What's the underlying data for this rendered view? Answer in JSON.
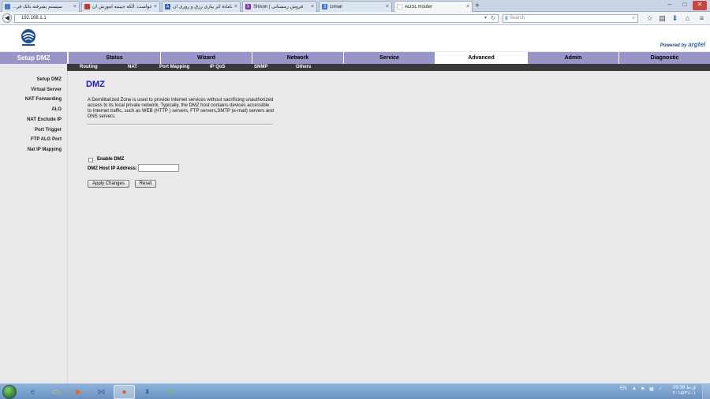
{
  "browser": {
    "tabs": [
      {
        "title": "...سیستم یشرفته بانک قر",
        "active": false,
        "fav_color": "#4a7bc0"
      },
      {
        "title": "درخواست: الکه جیبتیه آموزش ان...",
        "active": false,
        "fav_color": "#c0392b"
      },
      {
        "title": "سامانهٔ اثر بیاری رزق و روزی ان...",
        "active": false,
        "fav_color": "#2a5db0",
        "fav_glyph": "A"
      },
      {
        "title": "Shixon | فروش زمستانی",
        "active": false,
        "fav_color": "#7b2fa8",
        "fav_glyph": "X"
      },
      {
        "title": "Gmail",
        "active": false,
        "fav_color": "#3b6fd4",
        "fav_glyph": "3"
      },
      {
        "title": "ADSL Router",
        "active": true,
        "fav_color": "#ffffff"
      }
    ],
    "new_tab": "+",
    "close_glyph": "×",
    "url": "192.168.1.1",
    "search_placeholder": "Search",
    "window_controls": [
      "–",
      "□",
      "✕"
    ]
  },
  "router": {
    "powered_by_prefix": "Powered by",
    "powered_by_brand": "argtel",
    "section_title": "Setup DMZ",
    "main_nav": [
      "Status",
      "Wizard",
      "Network",
      "Service",
      "Advanced",
      "Admin",
      "Diagnostic"
    ],
    "active_main": "Advanced",
    "sub_nav": [
      "Routing",
      "NAT",
      "Port Mapping",
      "IP QoS",
      "SNMP",
      "Others"
    ],
    "sidebar": [
      "Setup DMZ",
      "Virtual Server",
      "NAT Forwarding",
      "ALG",
      "NAT Exclude IP",
      "Port Trigger",
      "FTP ALG Port",
      "Nat IP Mapping"
    ],
    "page_title": "DMZ",
    "description": "A Demilitarized Zone is used to provide Internet services without sacrificing unauthorized access to its local private network. Typically, the DMZ host contains devices accessible to Internet traffic, such as WEB (HTTP ) servers, FTP servers,SMTP (e-mail) servers and DNS servers.",
    "enable_dmz_label": "Enable DMZ",
    "enable_dmz_checked": false,
    "dmz_host_label": "DMZ Host IP Address:",
    "dmz_host_value": "",
    "apply_label": "Apply Changes",
    "reset_label": "Reset"
  },
  "taskbar": {
    "language": "EN",
    "time": "09:39 ق.ظ",
    "date": "۲۰۱۵/۳۱/۰۱"
  },
  "colors": {
    "nav_bg": "#9696c8",
    "subnav_bg": "#3a3a3a",
    "title_blue": "#1a1acc"
  }
}
